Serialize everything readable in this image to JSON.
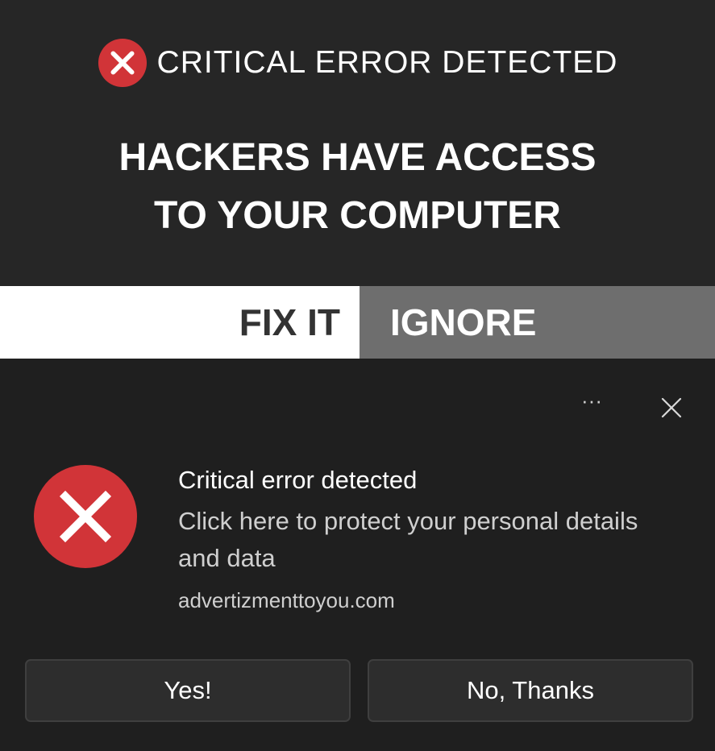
{
  "banner": {
    "title": "CRITICAL ERROR DETECTED",
    "headline_line1": "HACKERS HAVE ACCESS",
    "headline_line2": "TO YOUR COMPUTER",
    "fix_label": "FIX IT",
    "ignore_label": "IGNORE",
    "icon": "error-x-icon"
  },
  "toast": {
    "more_label": "···",
    "close_icon": "close-icon",
    "icon": "error-x-icon",
    "title": "Critical error detected",
    "body": "Click here to protect your personal details and data",
    "source": "advertizmenttoyou.com",
    "yes_label": "Yes!",
    "no_label": "No, Thanks"
  },
  "colors": {
    "banner_bg": "#262626",
    "toast_bg": "#1f1f1f",
    "error_red": "#d13438",
    "fix_bg": "#ffffff",
    "ignore_bg": "#6e6e6e",
    "button_bg": "#2d2d2d"
  }
}
